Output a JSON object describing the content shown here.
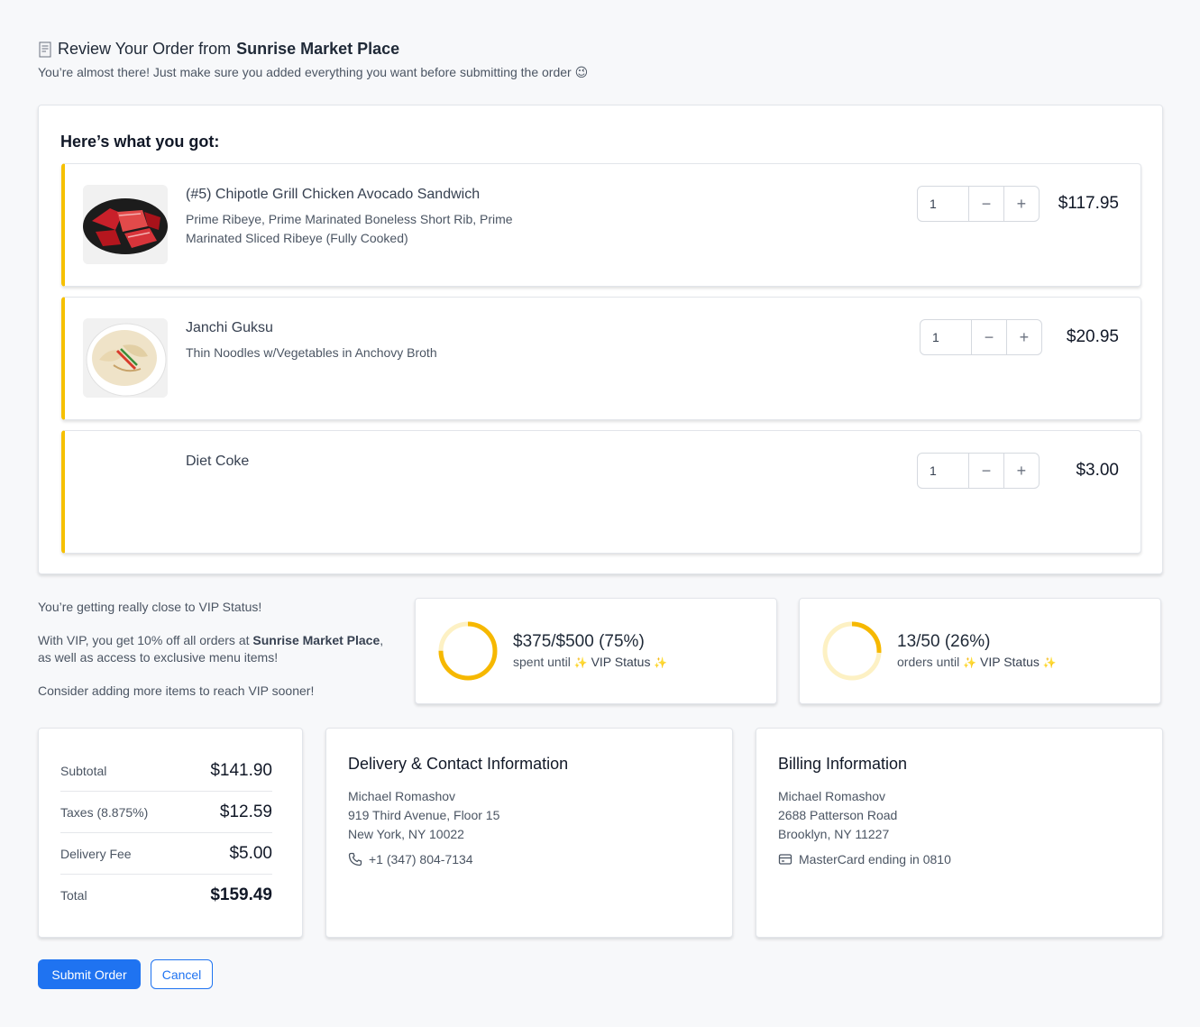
{
  "header": {
    "title_prefix": "Review Your Order from",
    "restaurant": "Sunrise Market Place",
    "subtitle": "You’re almost there! Just make sure you added everything you want before submitting the order 😉",
    "icon": "receipt-icon"
  },
  "order": {
    "heading": "Here’s what you got:",
    "items": [
      {
        "name": "(#5) Chipotle Grill Chicken Avocado Sandwich",
        "description": "Prime Ribeye, Prime Marinated Boneless Short Rib, Prime Marinated Sliced Ribeye (Fully Cooked)",
        "quantity": "1",
        "price": "$117.95",
        "image": "grilled-meat-platter"
      },
      {
        "name": "Janchi Guksu",
        "description": "Thin Noodles w/Vegetables in Anchovy Broth",
        "quantity": "1",
        "price": "$20.95",
        "image": "noodle-soup-bowl"
      },
      {
        "name": "Diet Coke",
        "description": "",
        "quantity": "1",
        "price": "$3.00"
      }
    ],
    "minus_label": "−",
    "plus_label": "+"
  },
  "vip": {
    "line1": "You’re getting really close to VIP Status!",
    "line2_pre": "With VIP, you get 10% off all orders at ",
    "line2_bold": "Sunrise Market Place",
    "line2_post": ", as well as access to exclusive menu items!",
    "line3": "Consider adding more items to reach VIP sooner!",
    "spend": {
      "main": "$375/$500 (75%)",
      "sub_pre": "spent until",
      "status": "VIP Status",
      "progress": 0.75
    },
    "orders": {
      "main": "13/50 (26%)",
      "sub_pre": "orders until",
      "status": "VIP Status",
      "progress": 0.26
    },
    "accent_color": "#f6b800",
    "track_color": "#fdf1c4"
  },
  "totals": {
    "subtotal_label": "Subtotal",
    "subtotal": "$141.90",
    "taxes_label": "Taxes (8.875%)",
    "taxes": "$12.59",
    "delivery_label": "Delivery Fee",
    "delivery": "$5.00",
    "total_label": "Total",
    "total": "$159.49"
  },
  "delivery": {
    "title": "Delivery & Contact Information",
    "name": "Michael Romashov",
    "address1": "919 Third Avenue, Floor 15",
    "address2": "New York, NY 10022",
    "phone": "+1 (347) 804-7134",
    "icon": "phone-icon"
  },
  "billing": {
    "title": "Billing Information",
    "name": "Michael Romashov",
    "address1": "2688 Patterson Road",
    "address2": "Brooklyn, NY 11227",
    "card": "MasterCard ending in 0810",
    "icon": "credit-card-icon"
  },
  "actions": {
    "submit": "Submit Order",
    "cancel": "Cancel"
  },
  "colors": {
    "primary": "#1f73f1",
    "accent": "#f6c000"
  }
}
